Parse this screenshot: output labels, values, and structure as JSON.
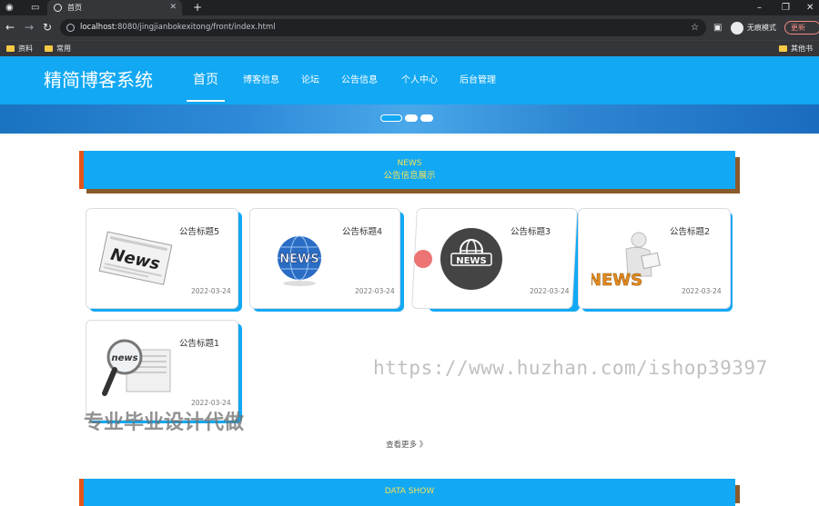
{
  "browser": {
    "tab_title": "首页",
    "url_host": "localhost",
    "url_rest": ":8080/jingjianbokexitong/front/index.html",
    "profile_label": "无痕模式",
    "update_label": "更新",
    "bookmarks": [
      "资料",
      "常用"
    ],
    "other_bookmarks": "其他书签"
  },
  "site": {
    "logo": "精简博客系统",
    "nav": [
      "首页",
      "博客信息",
      "论坛",
      "公告信息",
      "个人中心",
      "后台管理"
    ]
  },
  "notice_section": {
    "title_en": "NEWS",
    "title_cn": "公告信息展示",
    "cards": [
      {
        "title": "公告标题5",
        "date": "2022-03-24",
        "icon": "news-newspaper-icon"
      },
      {
        "title": "公告标题4",
        "date": "2022-03-24",
        "icon": "news-globe-icon"
      },
      {
        "title": "公告标题3",
        "date": "2022-03-24",
        "icon": "news-circle-globe-icon"
      },
      {
        "title": "公告标题2",
        "date": "2022-03-24",
        "icon": "news-3d-figure-icon"
      },
      {
        "title": "公告标题1",
        "date": "2022-03-24",
        "icon": "news-magnifier-icon"
      }
    ],
    "more_label": "查看更多 》"
  },
  "data_section": {
    "title_en": "DATA SHOW"
  },
  "overlays": {
    "watermark_url": "https://www.huzhan.com/ishop39397",
    "watermark_cn": "专业毕业设计代做"
  },
  "colors": {
    "primary": "#12a8f3",
    "accent_left": "#e1551d",
    "shadow_brown": "#8b5a2b",
    "title_yellow": "#f1e25a"
  }
}
